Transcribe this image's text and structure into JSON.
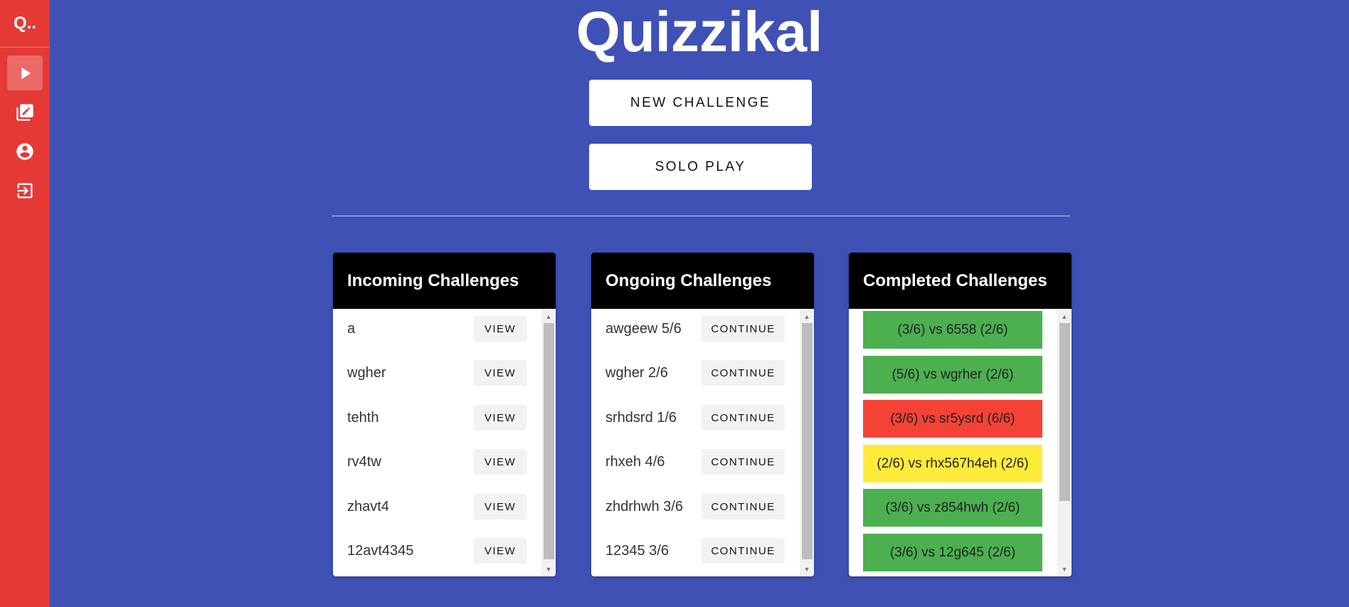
{
  "app": {
    "logo_text": "Q..",
    "title": "Quizzikal"
  },
  "sidebar": {
    "items": [
      {
        "icon": "play-icon",
        "active": true
      },
      {
        "icon": "edit-icon",
        "active": false
      },
      {
        "icon": "account-icon",
        "active": false
      },
      {
        "icon": "logout-icon",
        "active": false
      }
    ]
  },
  "actions": {
    "new_challenge": "NEW CHALLENGE",
    "solo_play": "SOLO PLAY"
  },
  "incoming": {
    "title": "Incoming Challenges",
    "button_label": "VIEW",
    "rows": [
      "a",
      "wgher",
      "tehth",
      "rv4tw",
      "zhavt4",
      "12avt4345"
    ]
  },
  "ongoing": {
    "title": "Ongoing Challenges",
    "button_label": "CONTINUE",
    "rows": [
      "awgeew 5/6",
      "wgher 2/6",
      "srhdsrd 1/6",
      "rhxeh 4/6",
      "zhdrhwh 3/6",
      "12345 3/6"
    ]
  },
  "completed": {
    "title": "Completed Challenges",
    "rows": [
      {
        "text": "(3/6) vs 6558 (2/6)",
        "status": "win"
      },
      {
        "text": "(5/6) vs wgrher (2/6)",
        "status": "win"
      },
      {
        "text": "(3/6) vs sr5ysrd (6/6)",
        "status": "loss"
      },
      {
        "text": "(2/6) vs rhx567h4eh (2/6)",
        "status": "tie"
      },
      {
        "text": "(3/6) vs z854hwh (2/6)",
        "status": "win"
      },
      {
        "text": "(3/6) vs 12g645 (2/6)",
        "status": "win"
      }
    ]
  },
  "colors": {
    "background": "#3f51b5",
    "sidebar": "#e53935",
    "win": "#4caf50",
    "loss": "#f44336",
    "tie": "#ffeb3b"
  }
}
